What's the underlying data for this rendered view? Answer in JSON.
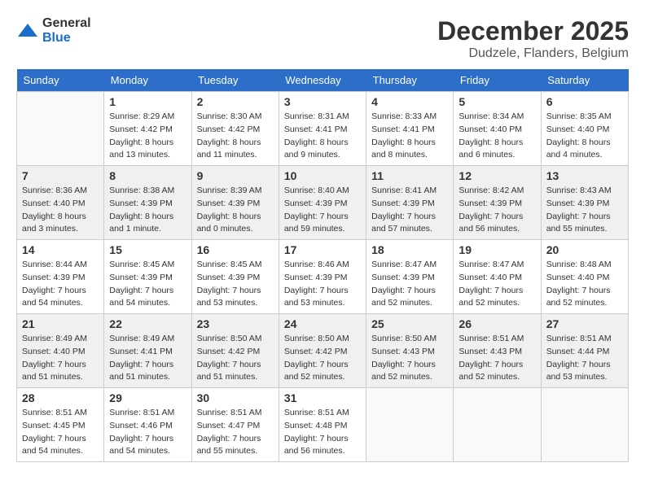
{
  "logo": {
    "general": "General",
    "blue": "Blue"
  },
  "header": {
    "month": "December 2025",
    "location": "Dudzele, Flanders, Belgium"
  },
  "weekdays": [
    "Sunday",
    "Monday",
    "Tuesday",
    "Wednesday",
    "Thursday",
    "Friday",
    "Saturday"
  ],
  "weeks": [
    [
      {
        "day": "",
        "info": ""
      },
      {
        "day": "1",
        "info": "Sunrise: 8:29 AM\nSunset: 4:42 PM\nDaylight: 8 hours\nand 13 minutes."
      },
      {
        "day": "2",
        "info": "Sunrise: 8:30 AM\nSunset: 4:42 PM\nDaylight: 8 hours\nand 11 minutes."
      },
      {
        "day": "3",
        "info": "Sunrise: 8:31 AM\nSunset: 4:41 PM\nDaylight: 8 hours\nand 9 minutes."
      },
      {
        "day": "4",
        "info": "Sunrise: 8:33 AM\nSunset: 4:41 PM\nDaylight: 8 hours\nand 8 minutes."
      },
      {
        "day": "5",
        "info": "Sunrise: 8:34 AM\nSunset: 4:40 PM\nDaylight: 8 hours\nand 6 minutes."
      },
      {
        "day": "6",
        "info": "Sunrise: 8:35 AM\nSunset: 4:40 PM\nDaylight: 8 hours\nand 4 minutes."
      }
    ],
    [
      {
        "day": "7",
        "info": "Sunrise: 8:36 AM\nSunset: 4:40 PM\nDaylight: 8 hours\nand 3 minutes."
      },
      {
        "day": "8",
        "info": "Sunrise: 8:38 AM\nSunset: 4:39 PM\nDaylight: 8 hours\nand 1 minute."
      },
      {
        "day": "9",
        "info": "Sunrise: 8:39 AM\nSunset: 4:39 PM\nDaylight: 8 hours\nand 0 minutes."
      },
      {
        "day": "10",
        "info": "Sunrise: 8:40 AM\nSunset: 4:39 PM\nDaylight: 7 hours\nand 59 minutes."
      },
      {
        "day": "11",
        "info": "Sunrise: 8:41 AM\nSunset: 4:39 PM\nDaylight: 7 hours\nand 57 minutes."
      },
      {
        "day": "12",
        "info": "Sunrise: 8:42 AM\nSunset: 4:39 PM\nDaylight: 7 hours\nand 56 minutes."
      },
      {
        "day": "13",
        "info": "Sunrise: 8:43 AM\nSunset: 4:39 PM\nDaylight: 7 hours\nand 55 minutes."
      }
    ],
    [
      {
        "day": "14",
        "info": "Sunrise: 8:44 AM\nSunset: 4:39 PM\nDaylight: 7 hours\nand 54 minutes."
      },
      {
        "day": "15",
        "info": "Sunrise: 8:45 AM\nSunset: 4:39 PM\nDaylight: 7 hours\nand 54 minutes."
      },
      {
        "day": "16",
        "info": "Sunrise: 8:45 AM\nSunset: 4:39 PM\nDaylight: 7 hours\nand 53 minutes."
      },
      {
        "day": "17",
        "info": "Sunrise: 8:46 AM\nSunset: 4:39 PM\nDaylight: 7 hours\nand 53 minutes."
      },
      {
        "day": "18",
        "info": "Sunrise: 8:47 AM\nSunset: 4:39 PM\nDaylight: 7 hours\nand 52 minutes."
      },
      {
        "day": "19",
        "info": "Sunrise: 8:47 AM\nSunset: 4:40 PM\nDaylight: 7 hours\nand 52 minutes."
      },
      {
        "day": "20",
        "info": "Sunrise: 8:48 AM\nSunset: 4:40 PM\nDaylight: 7 hours\nand 52 minutes."
      }
    ],
    [
      {
        "day": "21",
        "info": "Sunrise: 8:49 AM\nSunset: 4:40 PM\nDaylight: 7 hours\nand 51 minutes."
      },
      {
        "day": "22",
        "info": "Sunrise: 8:49 AM\nSunset: 4:41 PM\nDaylight: 7 hours\nand 51 minutes."
      },
      {
        "day": "23",
        "info": "Sunrise: 8:50 AM\nSunset: 4:42 PM\nDaylight: 7 hours\nand 51 minutes."
      },
      {
        "day": "24",
        "info": "Sunrise: 8:50 AM\nSunset: 4:42 PM\nDaylight: 7 hours\nand 52 minutes."
      },
      {
        "day": "25",
        "info": "Sunrise: 8:50 AM\nSunset: 4:43 PM\nDaylight: 7 hours\nand 52 minutes."
      },
      {
        "day": "26",
        "info": "Sunrise: 8:51 AM\nSunset: 4:43 PM\nDaylight: 7 hours\nand 52 minutes."
      },
      {
        "day": "27",
        "info": "Sunrise: 8:51 AM\nSunset: 4:44 PM\nDaylight: 7 hours\nand 53 minutes."
      }
    ],
    [
      {
        "day": "28",
        "info": "Sunrise: 8:51 AM\nSunset: 4:45 PM\nDaylight: 7 hours\nand 54 minutes."
      },
      {
        "day": "29",
        "info": "Sunrise: 8:51 AM\nSunset: 4:46 PM\nDaylight: 7 hours\nand 54 minutes."
      },
      {
        "day": "30",
        "info": "Sunrise: 8:51 AM\nSunset: 4:47 PM\nDaylight: 7 hours\nand 55 minutes."
      },
      {
        "day": "31",
        "info": "Sunrise: 8:51 AM\nSunset: 4:48 PM\nDaylight: 7 hours\nand 56 minutes."
      },
      {
        "day": "",
        "info": ""
      },
      {
        "day": "",
        "info": ""
      },
      {
        "day": "",
        "info": ""
      }
    ]
  ]
}
